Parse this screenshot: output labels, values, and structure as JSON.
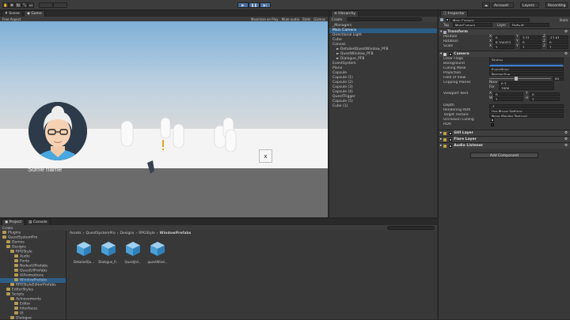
{
  "toolbar": {
    "play": "Play",
    "pause": "Pause",
    "step": "Step",
    "account": "Account",
    "layers": "Layers",
    "layout": "Recording"
  },
  "scene_tabs": [
    "Scene",
    "Game"
  ],
  "game_bar": {
    "aspect": "Free Aspect",
    "options": [
      "Maximize on Play",
      "Mute audio",
      "Stats",
      "Gizmos"
    ]
  },
  "viewport": {
    "caption": "Some name",
    "close": "x"
  },
  "hierarchy": {
    "tab": "Hierarchy",
    "create": "Create",
    "search": "",
    "items": [
      {
        "label": "_Managers",
        "indent": 0,
        "selected": false
      },
      {
        "label": "Main Camera",
        "indent": 0,
        "selected": true
      },
      {
        "label": "Directional Light",
        "indent": 0,
        "selected": false
      },
      {
        "label": "Cube",
        "indent": 0,
        "selected": false
      },
      {
        "label": "Canvas",
        "indent": 0,
        "selected": false
      },
      {
        "label": "► DetailedQuestWindow_PFB",
        "indent": 1,
        "selected": false
      },
      {
        "label": "► QuestWindow_PFB",
        "indent": 1,
        "selected": false
      },
      {
        "label": "► Dialogue_PFB",
        "indent": 1,
        "selected": false
      },
      {
        "label": "EventSystem",
        "indent": 0,
        "selected": false
      },
      {
        "label": "Plane",
        "indent": 0,
        "selected": false
      },
      {
        "label": "Capsule",
        "indent": 0,
        "selected": false
      },
      {
        "label": "Capsule (1)",
        "indent": 0,
        "selected": false
      },
      {
        "label": "Capsule (2)",
        "indent": 0,
        "selected": false
      },
      {
        "label": "Capsule (3)",
        "indent": 0,
        "selected": false
      },
      {
        "label": "Capsule (4)",
        "indent": 0,
        "selected": false
      },
      {
        "label": "QuestTrigger",
        "indent": 0,
        "selected": false
      },
      {
        "label": "Capsule (5)",
        "indent": 0,
        "selected": false
      },
      {
        "label": "Cube (1)",
        "indent": 0,
        "selected": false
      }
    ]
  },
  "inspector": {
    "tab": "Inspector",
    "object_name": "Main Camera",
    "static": "Static",
    "tag_label": "Tag",
    "tag": "MainCamera",
    "layer_label": "Layer",
    "layer": "Default",
    "transform": {
      "title": "Transform",
      "position": {
        "label": "Position",
        "x": "0",
        "y": "3.51",
        "z": "-12.61"
      },
      "rotation": {
        "label": "Rotation",
        "x": "8.104423",
        "y": "0",
        "z": "0"
      },
      "scale": {
        "label": "Scale",
        "x": "1",
        "y": "1",
        "z": "1"
      }
    },
    "camera": {
      "title": "Camera",
      "rows": [
        {
          "label": "Clear Flags",
          "value": "Skybox"
        },
        {
          "label": "Background",
          "value": ""
        },
        {
          "label": "Culling Mask",
          "value": "Everything"
        },
        {
          "label": "Projection",
          "value": "Perspective"
        },
        {
          "label": "Field of View",
          "value": "60"
        }
      ],
      "clipping": {
        "label": "Clipping Planes",
        "near_label": "Near",
        "near": "0.3",
        "far_label": "Far",
        "far": "1000"
      },
      "viewport": {
        "label": "Viewport Rect",
        "x": "0",
        "y": "0",
        "w": "1",
        "h": "1"
      },
      "rows2": [
        {
          "label": "Depth",
          "value": "-1"
        },
        {
          "label": "Rendering Path",
          "value": "Use Player Settings"
        },
        {
          "label": "Target Texture",
          "value": "None (Render Texture)"
        },
        {
          "label": "Occlusion Culling",
          "value": ""
        },
        {
          "label": "HDR",
          "value": ""
        }
      ]
    },
    "components": [
      "GUI Layer",
      "Flare Layer",
      "Audio Listener"
    ],
    "add_component": "Add Component"
  },
  "project": {
    "tabs": [
      "Project",
      "Console"
    ],
    "create": "Create",
    "breadcrumb": [
      "Assets",
      "QuestSystemPro",
      "Designs",
      "RPGStyle",
      "WindowPrefabs"
    ],
    "tree": [
      {
        "label": "Plugins",
        "indent": 0
      },
      {
        "label": "QuestSystemPro",
        "indent": 0
      },
      {
        "label": "Demos",
        "indent": 1
      },
      {
        "label": "Designs",
        "indent": 1
      },
      {
        "label": "RPGStyle",
        "indent": 2
      },
      {
        "label": "Audio",
        "indent": 3
      },
      {
        "label": "Fonts",
        "indent": 3
      },
      {
        "label": "NodesUIPrefabs",
        "indent": 3
      },
      {
        "label": "QuestUIPrefabs",
        "indent": 3
      },
      {
        "label": "UIAnimations",
        "indent": 3
      },
      {
        "label": "WindowPrefabs",
        "indent": 3,
        "selected": true
      },
      {
        "label": "RPGStyleEditorPrefabs",
        "indent": 2
      },
      {
        "label": "EditorStyles",
        "indent": 1
      },
      {
        "label": "Scripts",
        "indent": 1
      },
      {
        "label": "Achievements",
        "indent": 2
      },
      {
        "label": "Editor",
        "indent": 3
      },
      {
        "label": "Interfaces",
        "indent": 3
      },
      {
        "label": "UI",
        "indent": 3
      },
      {
        "label": "Dialogue",
        "indent": 2
      }
    ],
    "assets": [
      "DetailedQu...",
      "Dialogue_P...",
      "QuestJrd...",
      "questWind..."
    ]
  }
}
